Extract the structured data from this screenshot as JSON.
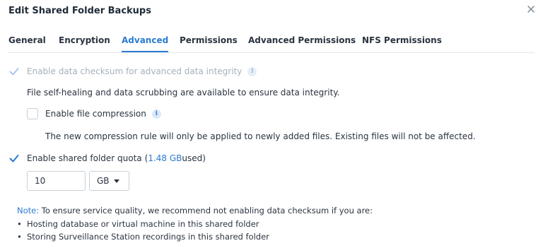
{
  "window": {
    "title": "Edit Shared Folder Backups",
    "close_icon": "close-icon"
  },
  "tabs": [
    "General",
    "Encryption",
    "Advanced",
    "Permissions",
    "Advanced Permissions",
    "NFS Permissions"
  ],
  "active_tab": "Advanced",
  "checksum": {
    "label": "Enable data checksum for advanced data integrity",
    "checked": true,
    "disabled": true,
    "info_icon": "i"
  },
  "self_healing_text": "File self-healing and data scrubbing are available to ensure data integrity.",
  "compression": {
    "label": "Enable file compression",
    "checked": false,
    "info_icon": "i"
  },
  "compression_note": "The new compression rule will only be applied to newly added files. Existing files will not be affected.",
  "quota": {
    "label": "Enable shared folder quota",
    "used_prefix": "(",
    "used_value": "1.48 GB",
    "used_suffix": " used)",
    "checked": true,
    "value": "10",
    "unit": "GB"
  },
  "note": {
    "label": "Note:",
    "text": " To ensure service quality, we recommend not enabling data checksum if you are:",
    "bullets": [
      "Hosting database or virtual machine in this shared folder",
      "Storing Surveillance Station recordings in this shared folder"
    ]
  },
  "colors": {
    "accent": "#2b7bd2",
    "text": "#2a3440",
    "muted": "#a7b0b9"
  }
}
